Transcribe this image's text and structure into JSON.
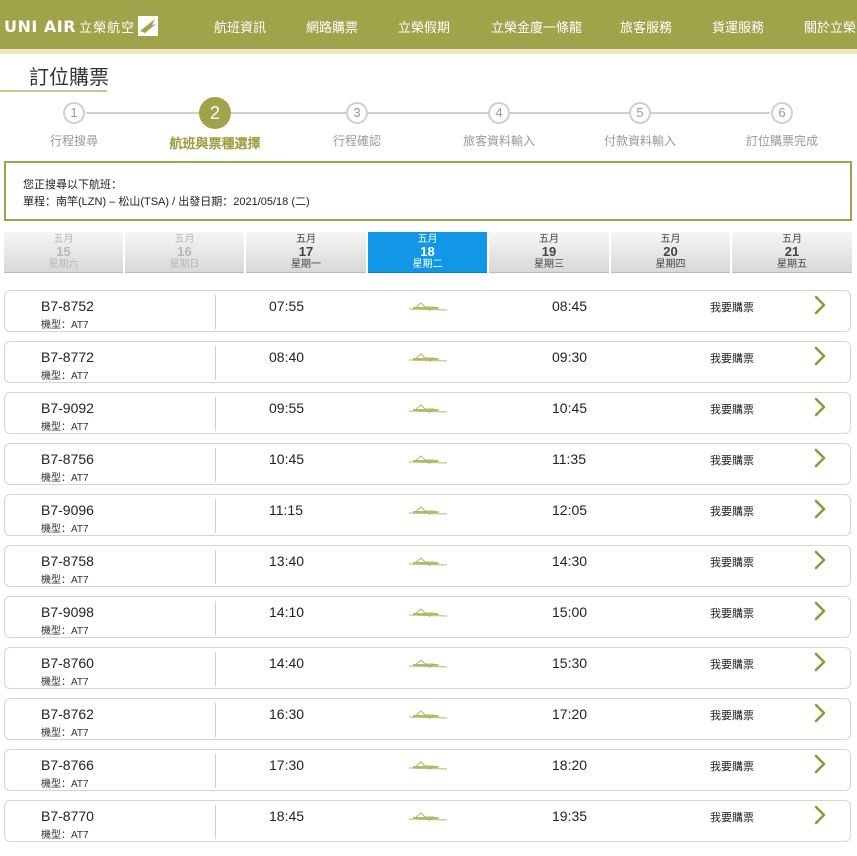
{
  "brand": {
    "logo_en": "UNI AIR",
    "logo_zh": "立榮航空",
    "accent_color": "#a0a34a",
    "selected_color": "#1197e6"
  },
  "nav": {
    "items": [
      "航班資訊",
      "網路購票",
      "立榮假期",
      "立榮金廈一條龍",
      "旅客服務",
      "貨運服務",
      "關於立榮"
    ]
  },
  "page": {
    "title": "訂位購票"
  },
  "steps": [
    {
      "num": "1",
      "label": "行程搜尋",
      "active": false
    },
    {
      "num": "2",
      "label": "航班與票種選擇",
      "active": true
    },
    {
      "num": "3",
      "label": "行程確認",
      "active": false
    },
    {
      "num": "4",
      "label": "旅客資料輸入",
      "active": false
    },
    {
      "num": "5",
      "label": "付款資料輸入",
      "active": false
    },
    {
      "num": "6",
      "label": "訂位購票完成",
      "active": false
    }
  ],
  "search": {
    "line1": "您正搜尋以下航班：",
    "line2": "單程：南竿(LZN) – 松山(TSA)  /  出發日期：2021/05/18 (二)"
  },
  "dates": [
    {
      "month": "五月",
      "day": "15",
      "weekday": "星期六",
      "state": "past"
    },
    {
      "month": "五月",
      "day": "16",
      "weekday": "星期日",
      "state": "past"
    },
    {
      "month": "五月",
      "day": "17",
      "weekday": "星期一",
      "state": "future"
    },
    {
      "month": "五月",
      "day": "18",
      "weekday": "星期二",
      "state": "selected"
    },
    {
      "month": "五月",
      "day": "19",
      "weekday": "星期三",
      "state": "future"
    },
    {
      "month": "五月",
      "day": "20",
      "weekday": "星期四",
      "state": "future"
    },
    {
      "month": "五月",
      "day": "21",
      "weekday": "星期五",
      "state": "future"
    }
  ],
  "buy_label": "我要購票",
  "flights": [
    {
      "no": "B7-8752",
      "aircraft": "機型：AT7",
      "dep": "07:55",
      "arr": "08:45"
    },
    {
      "no": "B7-8772",
      "aircraft": "機型：AT7",
      "dep": "08:40",
      "arr": "09:30"
    },
    {
      "no": "B7-9092",
      "aircraft": "機型：AT7",
      "dep": "09:55",
      "arr": "10:45"
    },
    {
      "no": "B7-8756",
      "aircraft": "機型：AT7",
      "dep": "10:45",
      "arr": "11:35"
    },
    {
      "no": "B7-9096",
      "aircraft": "機型：AT7",
      "dep": "11:15",
      "arr": "12:05"
    },
    {
      "no": "B7-8758",
      "aircraft": "機型：AT7",
      "dep": "13:40",
      "arr": "14:30"
    },
    {
      "no": "B7-9098",
      "aircraft": "機型：AT7",
      "dep": "14:10",
      "arr": "15:00"
    },
    {
      "no": "B7-8760",
      "aircraft": "機型：AT7",
      "dep": "14:40",
      "arr": "15:30"
    },
    {
      "no": "B7-8762",
      "aircraft": "機型：AT7",
      "dep": "16:30",
      "arr": "17:20"
    },
    {
      "no": "B7-8766",
      "aircraft": "機型：AT7",
      "dep": "17:30",
      "arr": "18:20"
    },
    {
      "no": "B7-8770",
      "aircraft": "機型：AT7",
      "dep": "18:45",
      "arr": "19:35"
    }
  ]
}
